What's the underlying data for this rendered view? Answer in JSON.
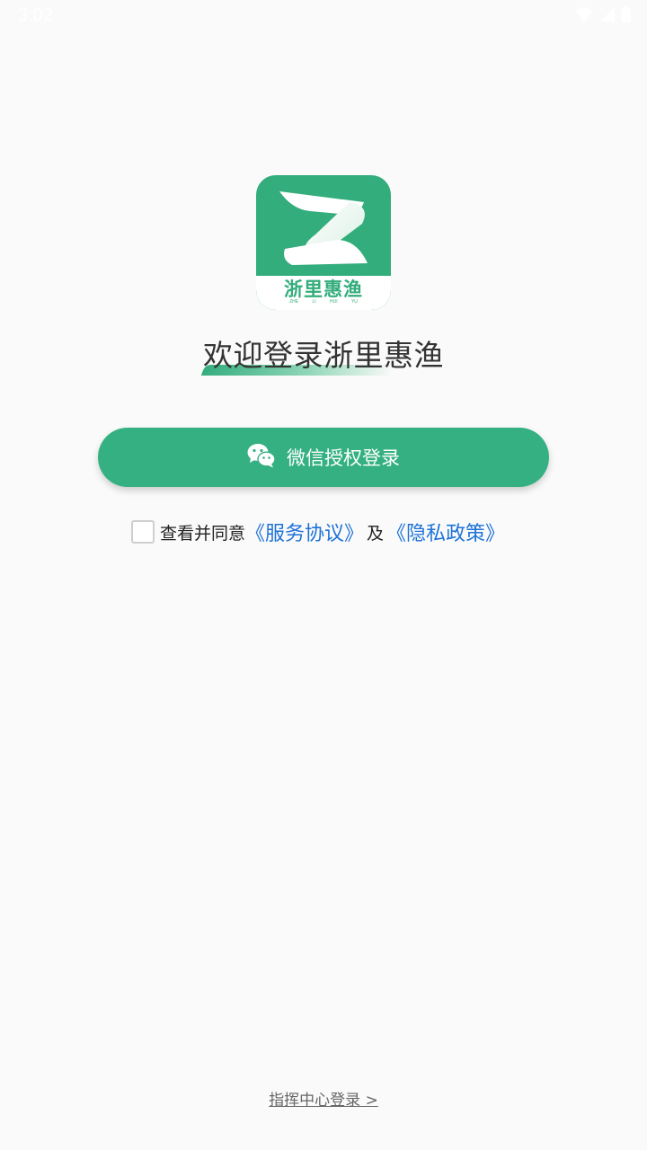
{
  "status_bar": {
    "time": "3:02",
    "icons": [
      "wifi-icon",
      "signal-icon",
      "battery-icon"
    ]
  },
  "logo": {
    "cn_text": "浙里惠渔",
    "pinyin": "ZHE LI HUI YU",
    "brand_color": "#34ad7c"
  },
  "title": "欢迎登录浙里惠渔",
  "wechat_login": {
    "label": "微信授权登录",
    "icon": "wechat-icon",
    "color": "#34b082"
  },
  "agreement": {
    "checked": false,
    "prefix": "查看并同意",
    "service_link": "《服务协议》",
    "and": "及",
    "privacy_link": "《隐私政策》",
    "link_color": "#1e73d6"
  },
  "footer": {
    "command_login": "指挥中心登录 >"
  }
}
